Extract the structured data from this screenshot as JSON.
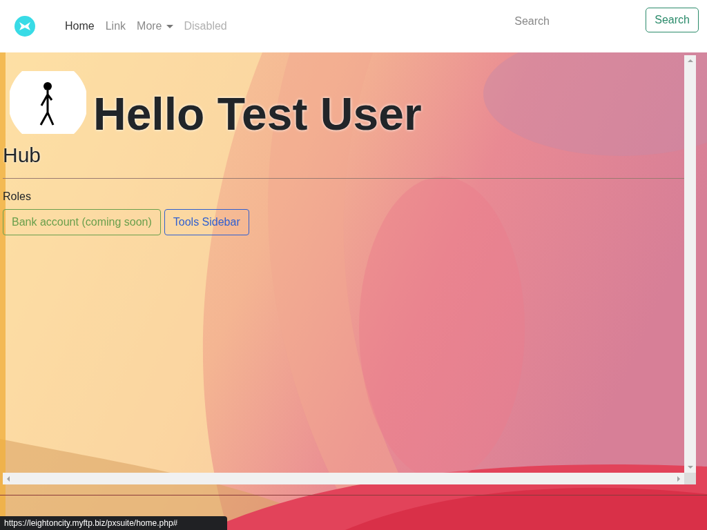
{
  "navbar": {
    "links": [
      {
        "kind": "link",
        "label": "Home",
        "selected": true,
        "disabled": false
      },
      {
        "kind": "link",
        "label": "Link",
        "selected": false,
        "disabled": false
      },
      {
        "kind": "dropdown",
        "label": "More",
        "selected": false,
        "disabled": false
      },
      {
        "kind": "link",
        "label": "Disabled",
        "selected": false,
        "disabled": true
      }
    ],
    "search": {
      "placeholder": "Search"
    },
    "search_button": "Search"
  },
  "hub": {
    "title": "Hello Test User",
    "subtitle": "Hub",
    "roles_label": "Roles",
    "roles": [
      {
        "label": "Bank account (coming soon)",
        "color": "#6a9f4c"
      },
      {
        "label": "Tools Sidebar",
        "color": "#2f5fd0"
      }
    ]
  },
  "status_bar": {
    "url": "https://leightoncity.myftp.biz/pxsuite/home.php#"
  }
}
